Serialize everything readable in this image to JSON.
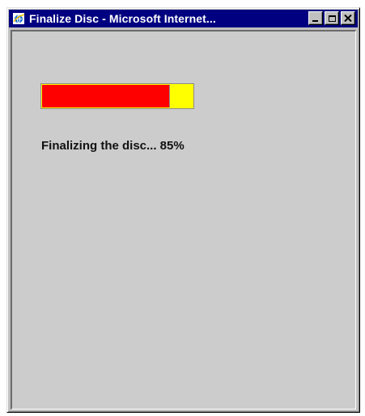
{
  "window": {
    "title": "Finalize Disc - Microsoft Internet..."
  },
  "icons": {
    "app": "internet-explorer-icon",
    "minimize": "minimize-icon",
    "maximize": "maximize-icon",
    "close": "close-icon"
  },
  "colors": {
    "titlebar": "#000080",
    "background": "#cccccc",
    "progress_fill": "#ff0000",
    "progress_remaining": "#ffff00"
  },
  "progress": {
    "percent": 85,
    "status_text": "Finalizing the disc... 85%"
  }
}
